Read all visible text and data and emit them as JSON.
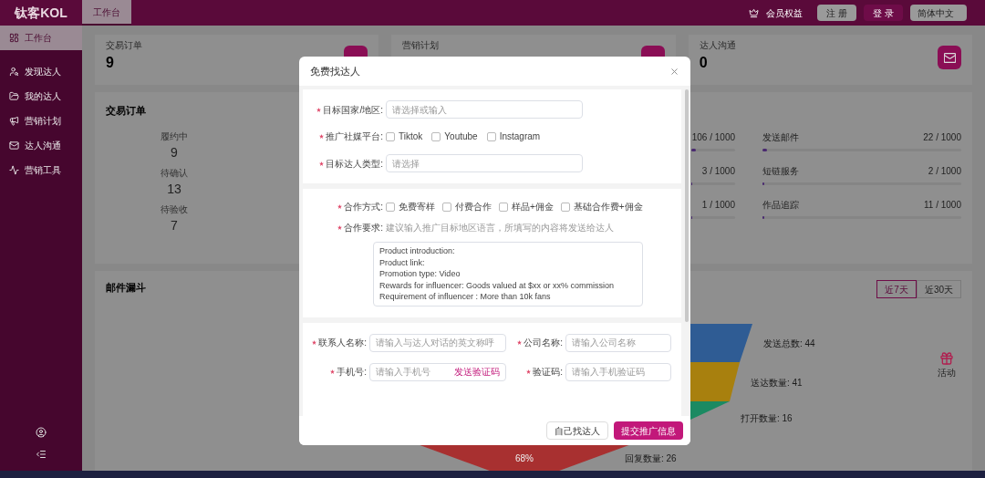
{
  "app": {
    "logo": "钛客KOL"
  },
  "top_tabs": [
    {
      "label": "工作台",
      "selected": true
    }
  ],
  "top_actions": {
    "membership": "会员权益",
    "register": "注 册",
    "login": "登 录",
    "language": "简体中文"
  },
  "sidebar": {
    "items": [
      {
        "label": "工作台",
        "selected": true
      },
      {
        "label": "发现达人",
        "selected": false
      },
      {
        "label": "我的达人",
        "selected": false
      },
      {
        "label": "营销计划",
        "selected": false
      },
      {
        "label": "达人沟通",
        "selected": false
      },
      {
        "label": "营销工具",
        "selected": false
      }
    ]
  },
  "stat_cards": [
    {
      "title": "交易订单",
      "value": "9"
    },
    {
      "title": "营销计划"
    },
    {
      "title": "达人沟通",
      "value": "0"
    }
  ],
  "orders": {
    "title": "交易订单",
    "stats": [
      {
        "label": "履约中",
        "value": "9"
      },
      {
        "label": "待确认",
        "value": "13"
      },
      {
        "label": "待验收",
        "value": "7"
      }
    ]
  },
  "quotas": [
    {
      "reading": "106 / 1000",
      "level": 0.106
    },
    {
      "label": "发送邮件",
      "reading": "22 / 1000",
      "level": 0.022
    },
    {
      "reading": "3 / 1000",
      "level": 0.003
    },
    {
      "label": "短链服务",
      "reading": "2 / 1000",
      "level": 0.002
    },
    {
      "reading": "1 / 1000",
      "level": 0.001
    },
    {
      "label": "作品追踪",
      "reading": "11 / 1000",
      "level": 0.011
    }
  ],
  "funnel": {
    "title": "邮件漏斗",
    "ranges": [
      {
        "label": "近7天",
        "selected": true
      },
      {
        "label": "近30天",
        "selected": false
      }
    ],
    "stages": [
      {
        "label": "发送总数: 44",
        "color": "#2f5c94"
      },
      {
        "label": "送达数量: 41",
        "color": "#a8800e"
      },
      {
        "label": "打开数量: 16",
        "color": "#1b8a62"
      },
      {
        "label": "回复数量: 26",
        "color": "#a83030"
      }
    ],
    "bottom_percent": "68%"
  },
  "activity": {
    "label": "活动"
  },
  "modal": {
    "title": "免费找达人",
    "section1": {
      "country": {
        "label": "目标国家/地区:",
        "required": true,
        "placeholder": "请选择或输入"
      },
      "platform": {
        "label": "推广社媒平台:",
        "required": true,
        "options": [
          {
            "label": "Tiktok",
            "checked": false
          },
          {
            "label": "Youtube",
            "checked": false
          },
          {
            "label": "Instagram",
            "checked": false
          }
        ]
      },
      "type": {
        "label": "目标达人类型:",
        "required": true,
        "placeholder": "请选择"
      }
    },
    "section2": {
      "mode": {
        "label": "合作方式:",
        "required": true,
        "options": [
          {
            "label": "免费寄样",
            "checked": false
          },
          {
            "label": "付费合作",
            "checked": false
          },
          {
            "label": "样品+佣金",
            "checked": false
          },
          {
            "label": "基础合作费+佣金",
            "checked": false
          }
        ]
      },
      "requirement": {
        "label": "合作要求:",
        "required": true,
        "hint": "建议输入推广目标地区语言，所填写的内容将发送给达人",
        "value": [
          "Product introduction:",
          "Product link:",
          "Promotion type: Video",
          "Rewards for influencer: Goods valued at $xx or xx% commission",
          "Requirement of influencer : More than 10k fans"
        ]
      }
    },
    "section3": {
      "contact": {
        "label": "联系人名称:",
        "required": true,
        "placeholder": "请输入与达人对话的英文称呼"
      },
      "company": {
        "label": "公司名称:",
        "required": true,
        "placeholder": "请输入公司名称"
      },
      "phone": {
        "label": "手机号:",
        "required": true,
        "placeholder": "请输入手机号",
        "action": "发送验证码"
      },
      "code": {
        "label": "验证码:",
        "required": true,
        "placeholder": "请输入手机验证码"
      }
    },
    "buttons": {
      "secondary": "自己找达人",
      "primary": "提交推广信息"
    }
  }
}
